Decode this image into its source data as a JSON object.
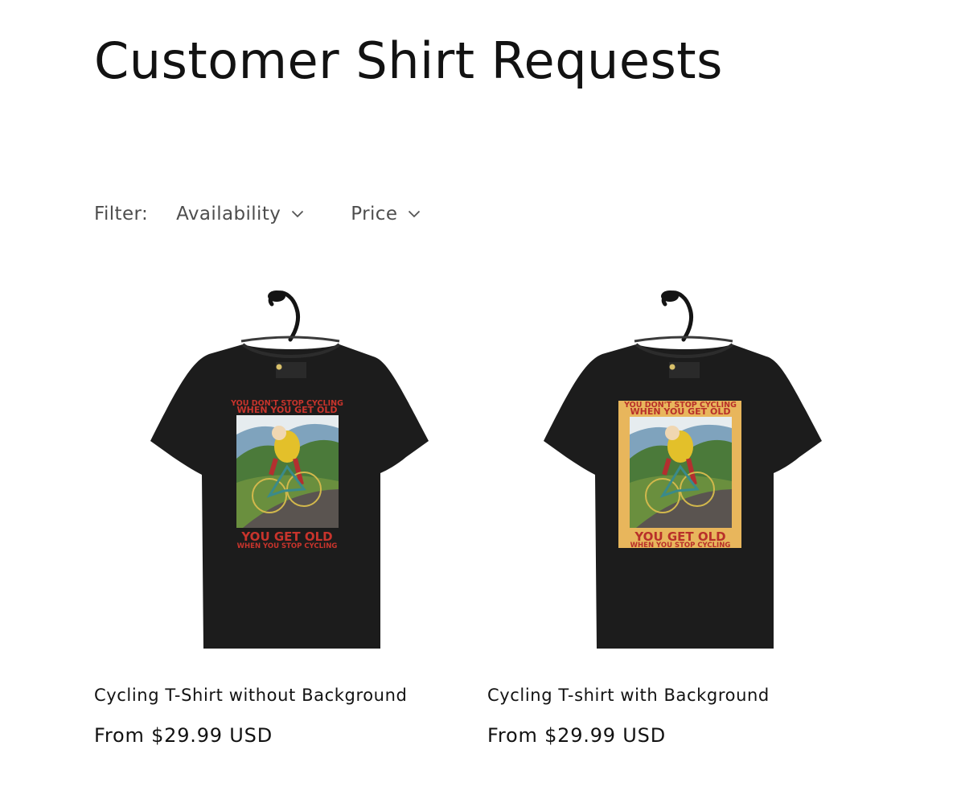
{
  "page": {
    "title": "Customer Shirt Requests"
  },
  "filters": {
    "label": "Filter:",
    "availability": "Availability",
    "price": "Price"
  },
  "products": [
    {
      "title": "Cycling T-Shirt without Background",
      "price": "From $29.99 USD",
      "print": {
        "top_line_1": "YOU DON'T STOP CYCLING",
        "top_line_2": "WHEN YOU GET OLD",
        "bottom_line_1": "YOU GET OLD",
        "bottom_line_2": "WHEN YOU STOP CYCLING",
        "background": false
      }
    },
    {
      "title": "Cycling T-shirt with Background",
      "price": "From $29.99 USD",
      "print": {
        "top_line_1": "YOU DON'T STOP CYCLING",
        "top_line_2": "WHEN YOU GET OLD",
        "bottom_line_1": "YOU GET OLD",
        "bottom_line_2": "WHEN YOU STOP CYCLING",
        "background": true
      }
    }
  ],
  "colors": {
    "shirt": "#1c1c1c",
    "print_red": "#c8342c",
    "print_bg": "#e8b65c",
    "hanger": "#141414"
  },
  "icons": {
    "filter_chevron": "chevron-down-icon",
    "hanger": "hanger-icon"
  }
}
